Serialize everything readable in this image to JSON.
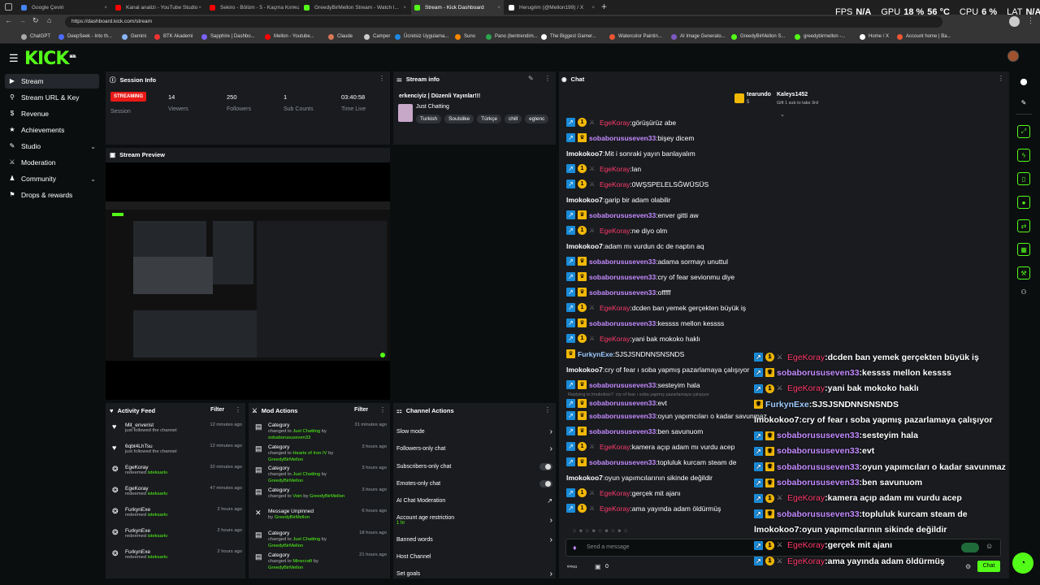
{
  "browser": {
    "tabs": [
      {
        "label": "Google Çeviri",
        "color": "#4285f4",
        "active": false
      },
      {
        "label": "Kanal analizi - YouTube Studio",
        "color": "#ff0000",
        "active": false
      },
      {
        "label": "Sekiro - Bölüm - 5 - Kaçma Kırmızı",
        "color": "#ff0000",
        "active": false
      },
      {
        "label": "GreedyBirMellon Stream - Watch l...",
        "color": "#53fc18",
        "active": false
      },
      {
        "label": "Stream - Kick Dashboard",
        "color": "#53fc18",
        "active": true
      },
      {
        "label": "Herugrim (@Mellon199) / X",
        "color": "#ffffff",
        "active": false
      }
    ],
    "url": "https://dashboard.kick.com/stream",
    "bookmarks": [
      "ChatGPT",
      "DeepSeek - Into th...",
      "Gemini",
      "BTK Akademi",
      "Sapphire | Dashbo...",
      "Mellon - Youtube...",
      "Claude",
      "Camper",
      "Ücretsiz Uygulama...",
      "Suno",
      "Pano (bentrendim...",
      "The Biggest Gamer...",
      "Watercolor Paintin...",
      "AI Image Generato...",
      "GreedyBirMellon S...",
      "greedybirmellon -...",
      "Home / X",
      "Account home | Ba..."
    ],
    "perf": {
      "fps_label": "FPS",
      "fps": "N/A",
      "gpu_label": "GPU",
      "gpu": "18 %",
      "gpu_temp": "56 °C",
      "cpu_label": "CPU",
      "cpu": "6 %",
      "lat_label": "LAT",
      "lat": "N/A"
    }
  },
  "kick": {
    "logo": "KICK",
    "logo_badge": "BETA",
    "sidebar": [
      {
        "label": "Stream",
        "icon": "▶"
      },
      {
        "label": "Stream URL & Key",
        "icon": "⚲"
      },
      {
        "label": "Revenue",
        "icon": "$"
      },
      {
        "label": "Achievements",
        "icon": "★"
      },
      {
        "label": "Studio",
        "icon": "✎"
      },
      {
        "label": "Moderation",
        "icon": "⚔"
      },
      {
        "label": "Community",
        "icon": "♟"
      },
      {
        "label": "Drops & rewards",
        "icon": "⚑"
      }
    ],
    "session": {
      "title": "Session Info",
      "badge": "STREAMING",
      "session_label": "Session",
      "stats": [
        {
          "value": "14",
          "label": "Viewers"
        },
        {
          "value": "250",
          "label": "Followers"
        },
        {
          "value": "1",
          "label": "Sub Counts"
        },
        {
          "value": "03:40:58",
          "label": "Time Live"
        }
      ]
    },
    "stream_info": {
      "title": "Stream info",
      "stream_title": "erkenciyiz | Düzenli Yayınlar!!!",
      "category": "Just Chatting",
      "tags": [
        "Turkish",
        "Soulslike",
        "Türkçe",
        "chill",
        "eglenc"
      ]
    },
    "preview": {
      "title": "Stream Preview"
    },
    "activity": {
      "title": "Activity Feed",
      "filter": "Filter",
      "items": [
        {
          "name": "Mit_enverist",
          "sub": "just followed the channel",
          "hl": "",
          "time": "12 minutes ago",
          "icon": "♥"
        },
        {
          "name": "6qbt4LhTsu",
          "sub": "just followed the channel",
          "hl": "",
          "time": "12 minutes ago",
          "icon": "♥"
        },
        {
          "name": "EgeKoray",
          "sub": "redeemed",
          "hl": "isteksarkı",
          "time": "32 minutes ago",
          "icon": "❂"
        },
        {
          "name": "EgeKoray",
          "sub": "redeemed",
          "hl": "isteksarkı",
          "time": "47 minutes ago",
          "icon": "❂"
        },
        {
          "name": "FurkynExe",
          "sub": "redeemed",
          "hl": "isteksarkı",
          "time": "2 hours ago",
          "icon": "❂"
        },
        {
          "name": "FurkynExe",
          "sub": "redeemed",
          "hl": "isteksarkı",
          "time": "2 hours ago",
          "icon": "❂"
        },
        {
          "name": "FurkynExe",
          "sub": "redeemed",
          "hl": "isteksarkı",
          "time": "2 hours ago",
          "icon": "❂"
        }
      ]
    },
    "mod": {
      "title": "Mod Actions",
      "filter": "Filter",
      "items": [
        {
          "name": "Category",
          "l1": "changed to",
          "v1": "Just Chatting",
          "l2": "by",
          "v2": "sobaborususeven33",
          "time": "31 minutes ago",
          "icon": "▤"
        },
        {
          "name": "Category",
          "l1": "changed to",
          "v1": "Hearts of Iron IV",
          "l2": "by",
          "v2": "GreedyBirMellon",
          "time": "3 hours ago",
          "icon": "▤"
        },
        {
          "name": "Category",
          "l1": "changed to",
          "v1": "Just Chatting",
          "l2": "by",
          "v2": "GreedyBirMellon",
          "time": "3 hours ago",
          "icon": "▤"
        },
        {
          "name": "Category",
          "l1": "changed to",
          "v1": "Voin",
          "l2": "by",
          "v2": "GreedyBirMellon",
          "time": "3 hours ago",
          "icon": "▤"
        },
        {
          "name": "Message Unpinned",
          "l1": "by",
          "v1": "GreedyBirMellon",
          "l2": "",
          "v2": "",
          "time": "6 hours ago",
          "icon": "✕"
        },
        {
          "name": "Category",
          "l1": "changed to",
          "v1": "Just Chatting",
          "l2": "by",
          "v2": "GreedyBirMellon",
          "time": "18 hours ago",
          "icon": "▤"
        },
        {
          "name": "Category",
          "l1": "changed to",
          "v1": "Minecraft",
          "l2": "by",
          "v2": "GreedyBirMellon",
          "time": "21 hours ago",
          "icon": "▤"
        }
      ]
    },
    "channel": {
      "title": "Channel Actions",
      "items": [
        {
          "label": "Slow mode",
          "control": "chevron",
          "sub": ""
        },
        {
          "label": "Followers-only chat",
          "control": "chevron",
          "sub": ""
        },
        {
          "label": "Subscribers-only chat",
          "control": "toggle",
          "sub": ""
        },
        {
          "label": "Emotes-only chat",
          "control": "toggle",
          "sub": ""
        },
        {
          "label": "AI Chat Moderation",
          "control": "external",
          "sub": ""
        },
        {
          "label": "Account age restriction",
          "control": "chevron",
          "sub": "1 hr"
        },
        {
          "label": "Banned words",
          "control": "chevron",
          "sub": ""
        },
        {
          "label": "Host Channel",
          "control": "none",
          "sub": ""
        },
        {
          "label": "Set goals",
          "control": "chevron",
          "sub": ""
        }
      ]
    },
    "chat": {
      "title": "Chat",
      "top_gifter": {
        "name": "tearundo",
        "count": "5"
      },
      "second": {
        "name": "Kaleys1452",
        "sub": "Gift 1 sub to take 3rd"
      },
      "reply_note": "Replying to lmokokoo7: cry of fear ı soba yapmış pazarlamaya çalışıyor",
      "input_placeholder": "Send a message",
      "send_label": "Chat",
      "viewer_count": "0",
      "messages": [
        {
          "b": "ee",
          "u": "EgeKoray",
          "c": "u-ege",
          "t": "görüşürüz abe"
        },
        {
          "b": "bs",
          "u": "sobaborususeven33",
          "c": "u-sob",
          "t": "bişey dicem"
        },
        {
          "b": "",
          "u": "lmokokoo7",
          "c": "u-imo",
          "t": "Mit i sonraki yayın banlayalım"
        },
        {
          "b": "ee",
          "u": "EgeKoray",
          "c": "u-ege",
          "t": "lan"
        },
        {
          "b": "ee",
          "u": "EgeKoray",
          "c": "u-ege",
          "t": "0WŞSPELELSĞWÜSÜS"
        },
        {
          "b": "",
          "u": "lmokokoo7",
          "c": "u-imo",
          "t": "garip bir adam olabilir"
        },
        {
          "b": "bs",
          "u": "sobaborususeven33",
          "c": "u-sob",
          "t": "enver gitti aw"
        },
        {
          "b": "ee",
          "u": "EgeKoray",
          "c": "u-ege",
          "t": "ne diyo olm"
        },
        {
          "b": "",
          "u": "lmokokoo7",
          "c": "u-imo",
          "t": "adam mı vurdun dc de naptın aq"
        },
        {
          "b": "bs",
          "u": "sobaborususeven33",
          "c": "u-sob",
          "t": "adama sormayı unuttul"
        },
        {
          "b": "bs",
          "u": "sobaborususeven33",
          "c": "u-sob",
          "t": "cry of fear sevionmu diye"
        },
        {
          "b": "bs",
          "u": "sobaborususeven33",
          "c": "u-sob",
          "t": "offfff"
        },
        {
          "b": "ee",
          "u": "EgeKoray",
          "c": "u-ege",
          "t": "dcden ban yemek gerçekten büyük iş"
        },
        {
          "b": "bs",
          "u": "sobaborususeven33",
          "c": "u-sob",
          "t": "kessss mellon kessss"
        },
        {
          "b": "ee",
          "u": "EgeKoray",
          "c": "u-ege",
          "t": "yani bak mokoko haklı"
        },
        {
          "b": "f",
          "u": "FurkynExe",
          "c": "u-fur",
          "t": "SJSJSNDNNSNSNDS"
        },
        {
          "b": "",
          "u": "lmokokoo7",
          "c": "u-imo",
          "t": "cry of fear ı soba yapmış pazarlamaya çalışıyor"
        },
        {
          "b": "bs",
          "u": "sobaborususeven33",
          "c": "u-sob",
          "t": "sesteyim hala"
        },
        {
          "b": "bs",
          "u": "sobaborususeven33",
          "c": "u-sob",
          "t": "evt",
          "reply": true
        },
        {
          "b": "bs",
          "u": "sobaborususeven33",
          "c": "u-sob",
          "t": "oyun yapımcıları o kadar savunmaz"
        },
        {
          "b": "bs",
          "u": "sobaborususeven33",
          "c": "u-sob",
          "t": "ben savunuom"
        },
        {
          "b": "ee",
          "u": "EgeKoray",
          "c": "u-ege",
          "t": "kamera açıp adam mı vurdu acep"
        },
        {
          "b": "bs",
          "u": "sobaborususeven33",
          "c": "u-sob",
          "t": "topluluk kurcam steam de"
        },
        {
          "b": "",
          "u": "lmokokoo7",
          "c": "u-imo",
          "t": "oyun yapımcılarının sikinde değildir"
        },
        {
          "b": "ee",
          "u": "EgeKoray",
          "c": "u-ege",
          "t": "gerçek mit ajanı"
        },
        {
          "b": "ee",
          "u": "EgeKoray",
          "c": "u-ege",
          "t": "ama yayında adam öldürmüş"
        }
      ]
    },
    "overlay_messages": [
      {
        "b": "ee",
        "u": "EgeKoray",
        "c": "u-ege",
        "t": "dcden ban yemek gerçekten büyük iş"
      },
      {
        "b": "bs",
        "u": "sobaborususeven33",
        "c": "u-sob",
        "t": "kessss mellon kessss"
      },
      {
        "b": "ee",
        "u": "EgeKoray",
        "c": "u-ege",
        "t": "yani bak mokoko haklı"
      },
      {
        "b": "f",
        "u": "FurkynExe",
        "c": "u-fur",
        "t": "SJSJSNDNNSNSNDS"
      },
      {
        "b": "",
        "u": "lmokokoo7",
        "c": "u-imo",
        "t": "cry of fear ı soba yapmış pazarlamaya çalışıyor"
      },
      {
        "b": "bs",
        "u": "sobaborususeven33",
        "c": "u-sob",
        "t": "sesteyim hala"
      },
      {
        "b": "bs",
        "u": "sobaborususeven33",
        "c": "u-sob",
        "t": "evt"
      },
      {
        "b": "bs",
        "u": "sobaborususeven33",
        "c": "u-sob",
        "t": "oyun yapımcıları o kadar savunmaz"
      },
      {
        "b": "bs",
        "u": "sobaborususeven33",
        "c": "u-sob",
        "t": "ben savunuom"
      },
      {
        "b": "ee",
        "u": "EgeKoray",
        "c": "u-ege",
        "t": "kamera açıp adam mı vurdu acep"
      },
      {
        "b": "bs",
        "u": "sobaborususeven33",
        "c": "u-sob",
        "t": "topluluk kurcam steam de"
      },
      {
        "b": "",
        "u": "lmokokoo7",
        "c": "u-imo",
        "t": "oyun yapımcılarının sikinde değildir"
      },
      {
        "b": "ee",
        "u": "EgeKoray",
        "c": "u-ege",
        "t": "gerçek mit ajanı"
      },
      {
        "b": "ee",
        "u": "EgeKoray",
        "c": "u-ege",
        "t": "ama yayında adam öldürmüş"
      }
    ],
    "colors": {
      "accent": "#53fc18",
      "streaming": "#e91916",
      "panel": "#191b1f",
      "bg": "#0b0e0f"
    }
  }
}
